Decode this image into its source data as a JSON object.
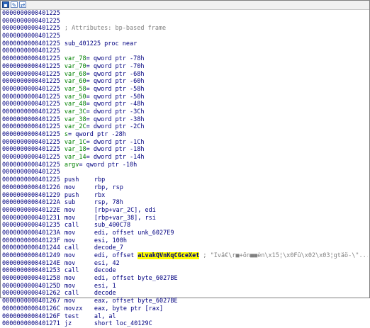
{
  "toolbar": {
    "icons": [
      "graph-view-icon",
      "edit-icon",
      "synchronize-icon"
    ]
  },
  "lines": [
    {
      "addr": "0000000000401225",
      "text": ""
    },
    {
      "addr": "0000000000401225",
      "text": ""
    },
    {
      "addr": "0000000000401225",
      "comment": "; Attributes: bp-based frame"
    },
    {
      "addr": "0000000000401225",
      "text": ""
    },
    {
      "addr": "0000000000401225",
      "proc": "sub_401225 proc near"
    },
    {
      "addr": "0000000000401225",
      "text": ""
    },
    {
      "addr": "0000000000401225",
      "var": "var_78",
      "def": "= qword ptr -78h"
    },
    {
      "addr": "0000000000401225",
      "var": "var_70",
      "def": "= qword ptr -70h"
    },
    {
      "addr": "0000000000401225",
      "var": "var_68",
      "def": "= qword ptr -68h"
    },
    {
      "addr": "0000000000401225",
      "var": "var_60",
      "def": "= qword ptr -60h"
    },
    {
      "addr": "0000000000401225",
      "var": "var_58",
      "def": "= qword ptr -58h"
    },
    {
      "addr": "0000000000401225",
      "var": "var_50",
      "def": "= qword ptr -50h"
    },
    {
      "addr": "0000000000401225",
      "var": "var_48",
      "def": "= qword ptr -48h"
    },
    {
      "addr": "0000000000401225",
      "var": "var_3C",
      "def": "= dword ptr -3Ch"
    },
    {
      "addr": "0000000000401225",
      "var": "var_38",
      "def": "= qword ptr -38h"
    },
    {
      "addr": "0000000000401225",
      "var": "var_2C",
      "def": "= dword ptr -2Ch"
    },
    {
      "addr": "0000000000401225",
      "var": "s",
      "def": "= qword ptr -28h"
    },
    {
      "addr": "0000000000401225",
      "var": "var_1C",
      "def": "= dword ptr -1Ch"
    },
    {
      "addr": "0000000000401225",
      "var": "var_18",
      "def": "= dword ptr -18h"
    },
    {
      "addr": "0000000000401225",
      "var": "var_14",
      "def": "= dword ptr -14h"
    },
    {
      "addr": "0000000000401225",
      "var": "argv",
      "def": "= qword ptr -10h"
    },
    {
      "addr": "0000000000401225",
      "text": ""
    },
    {
      "addr": "0000000000401225",
      "mn": "push",
      "op": "rbp"
    },
    {
      "addr": "0000000000401226",
      "mn": "mov",
      "op": "rbp, rsp"
    },
    {
      "addr": "0000000000401229",
      "mn": "push",
      "op": "rbx"
    },
    {
      "addr": "000000000040122A",
      "mn": "sub",
      "op": "rsp, 78h"
    },
    {
      "addr": "000000000040122E",
      "mn": "mov",
      "op": "[rbp+var_2C], edi"
    },
    {
      "addr": "0000000000401231",
      "mn": "mov",
      "op": "[rbp+var_38], rsi"
    },
    {
      "addr": "0000000000401235",
      "mn": "call",
      "op": "sub_400C78"
    },
    {
      "addr": "000000000040123A",
      "mn": "mov",
      "op": "edi, offset unk_6027E9"
    },
    {
      "addr": "000000000040123F",
      "mn": "mov",
      "op": "esi, 100h"
    },
    {
      "addr": "0000000000401244",
      "mn": "call",
      "op": "decode_7"
    },
    {
      "addr": "0000000000401249",
      "mn": "mov",
      "op": "edi, offset ",
      "highlight": "aLvakQVnKqCGceXet",
      "trail": " ; \"Ïvå€\\r■+ön■■èn\\x15¦\\x0Fû\\x02\\x03¦gtåö-\\\"..."
    },
    {
      "addr": "000000000040124E",
      "mn": "mov",
      "op": "esi, 42"
    },
    {
      "addr": "0000000000401253",
      "mn": "call",
      "op": "decode"
    },
    {
      "addr": "0000000000401258",
      "mn": "mov",
      "op": "edi, offset byte_6027BE"
    },
    {
      "addr": "000000000040125D",
      "mn": "mov",
      "op": "esi, 1"
    },
    {
      "addr": "0000000000401262",
      "mn": "call",
      "op": "decode"
    },
    {
      "addr": "0000000000401267",
      "mn": "mov",
      "op": "eax, offset byte_6027BE"
    },
    {
      "addr": "000000000040126C",
      "mn": "movzx",
      "op": "eax, byte ptr [rax]"
    },
    {
      "addr": "000000000040126F",
      "mn": "test",
      "op": "al, al"
    },
    {
      "addr": "0000000000401271",
      "mn": "jz",
      "op": "short loc_40129C"
    }
  ]
}
